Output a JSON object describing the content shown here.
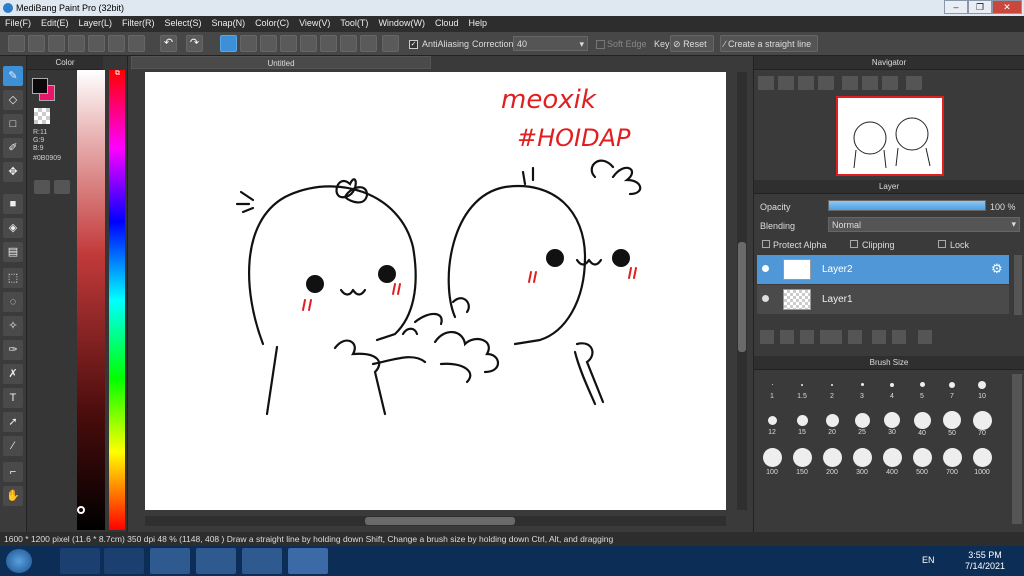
{
  "window": {
    "title": "MediBang Paint Pro (32bit)"
  },
  "menu": [
    "File(F)",
    "Edit(E)",
    "Layer(L)",
    "Filter(R)",
    "Select(S)",
    "Snap(N)",
    "Color(C)",
    "View(V)",
    "Tool(T)",
    "Window(W)",
    "Cloud",
    "Help"
  ],
  "toolbar": {
    "antialiasing": "AntiAliasing",
    "correction_label": "Correction",
    "correction_value": "40",
    "soft_edge": "Soft Edge",
    "key_label": "Key",
    "reset": "Reset",
    "straight_line": "Create a straight line"
  },
  "color_panel": {
    "title": "Color",
    "r": "R:11",
    "g": "G:9",
    "b": "B:9",
    "hex": "#0B0909",
    "fg": "#0b0909",
    "bg": "#e8156a"
  },
  "canvas": {
    "tab": "Untitled",
    "text1": "meoxik",
    "text2": "#HOIDAP"
  },
  "navigator": {
    "title": "Navigator"
  },
  "layer_panel": {
    "title": "Layer",
    "opacity_label": "Opacity",
    "opacity_value": "100 %",
    "opacity": 1.0,
    "blending_label": "Blending",
    "blending_value": "Normal",
    "protect_alpha": "Protect Alpha",
    "clipping": "Clipping",
    "lock": "Lock",
    "layers": [
      "Layer2",
      "Layer1"
    ]
  },
  "brush_panel": {
    "title": "Brush Size",
    "sizes": [
      "1",
      "1.5",
      "2",
      "3",
      "4",
      "5",
      "7",
      "10",
      "12",
      "15",
      "20",
      "25",
      "30",
      "40",
      "50",
      "70",
      "100",
      "150",
      "200",
      "300",
      "400",
      "500",
      "700",
      "1000"
    ]
  },
  "status": {
    "text": "1600 * 1200 pixel   (11.6 * 8.7cm)   350 dpi   48 %   (1148, 408 )   Draw a straight line by holding down Shift, Change a brush size by holding down Ctrl, Alt, and dragging"
  },
  "taskbar": {
    "time": "3:55 PM",
    "date": "7/14/2021",
    "lang": "EN"
  },
  "colors": {
    "accent": "#3d8fd6",
    "red_text": "#e02020"
  }
}
